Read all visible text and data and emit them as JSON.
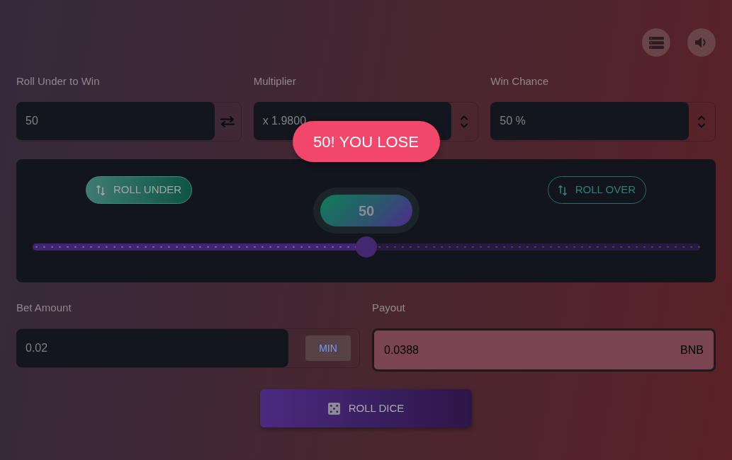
{
  "fields": [
    {
      "label": "Roll Under to Win",
      "value": "50",
      "kind": "swap"
    },
    {
      "label": "Multiplier",
      "value": "x 1.9800",
      "kind": "stepper"
    },
    {
      "label": "Win Chance",
      "value": "50 %",
      "kind": "stepper"
    }
  ],
  "toast": {
    "text": "50! YOU LOSE"
  },
  "modes": [
    {
      "label": "ROLL UNDER",
      "selected": true
    },
    {
      "label": "ROLL OVER",
      "selected": false
    }
  ],
  "slider": {
    "value": "50",
    "level": 0.5
  },
  "bet": {
    "label": "Bet Amount",
    "value": "0.02",
    "button": "MIN"
  },
  "payout": {
    "label": "Payout",
    "value": "0.0388",
    "currency": "BNB"
  },
  "roll_button": {
    "label": "ROLL DICE"
  }
}
